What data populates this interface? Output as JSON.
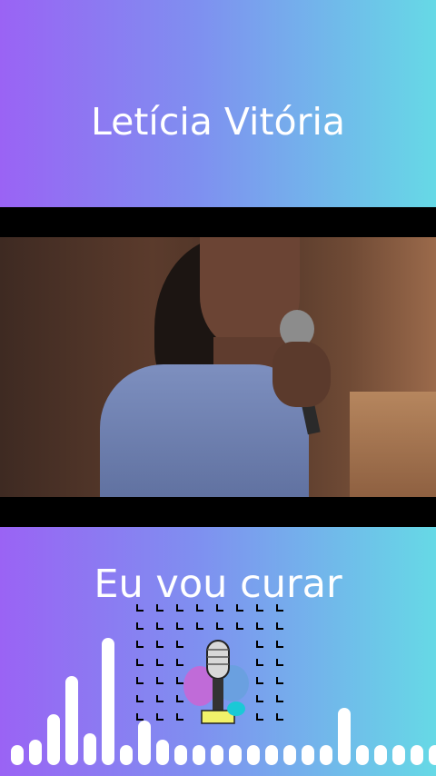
{
  "header": {
    "title": "Letícia Vitória"
  },
  "video": {
    "description_icon": "singer-with-microphone"
  },
  "lyric": {
    "text": "Eu vou curar"
  },
  "visualizer": {
    "bars": [
      {
        "h": 0.1
      },
      {
        "h": 0.2
      },
      {
        "h": 0.4
      },
      {
        "h": 0.7
      },
      {
        "h": 0.25
      },
      {
        "h": 1.0
      },
      {
        "h": 0.15
      },
      {
        "h": 0.35
      },
      {
        "h": 0.2
      },
      {
        "h": 0.15
      },
      {
        "h": 0.15
      },
      {
        "h": 0.15
      },
      {
        "h": 0.15
      },
      {
        "h": 0.15
      },
      {
        "h": 0.15
      },
      {
        "h": 0.15
      },
      {
        "h": 0.15
      },
      {
        "h": 0.15
      },
      {
        "h": 0.45
      },
      {
        "h": 0.15
      },
      {
        "h": 0.15
      },
      {
        "h": 0.15
      },
      {
        "h": 0.15
      },
      {
        "h": 0.15
      }
    ]
  },
  "badge": {
    "icon": "microphone-sticker-icon"
  },
  "colors": {
    "gradient_start": "#9a63f4",
    "gradient_end": "#66d9e6",
    "text": "#ffffff"
  }
}
